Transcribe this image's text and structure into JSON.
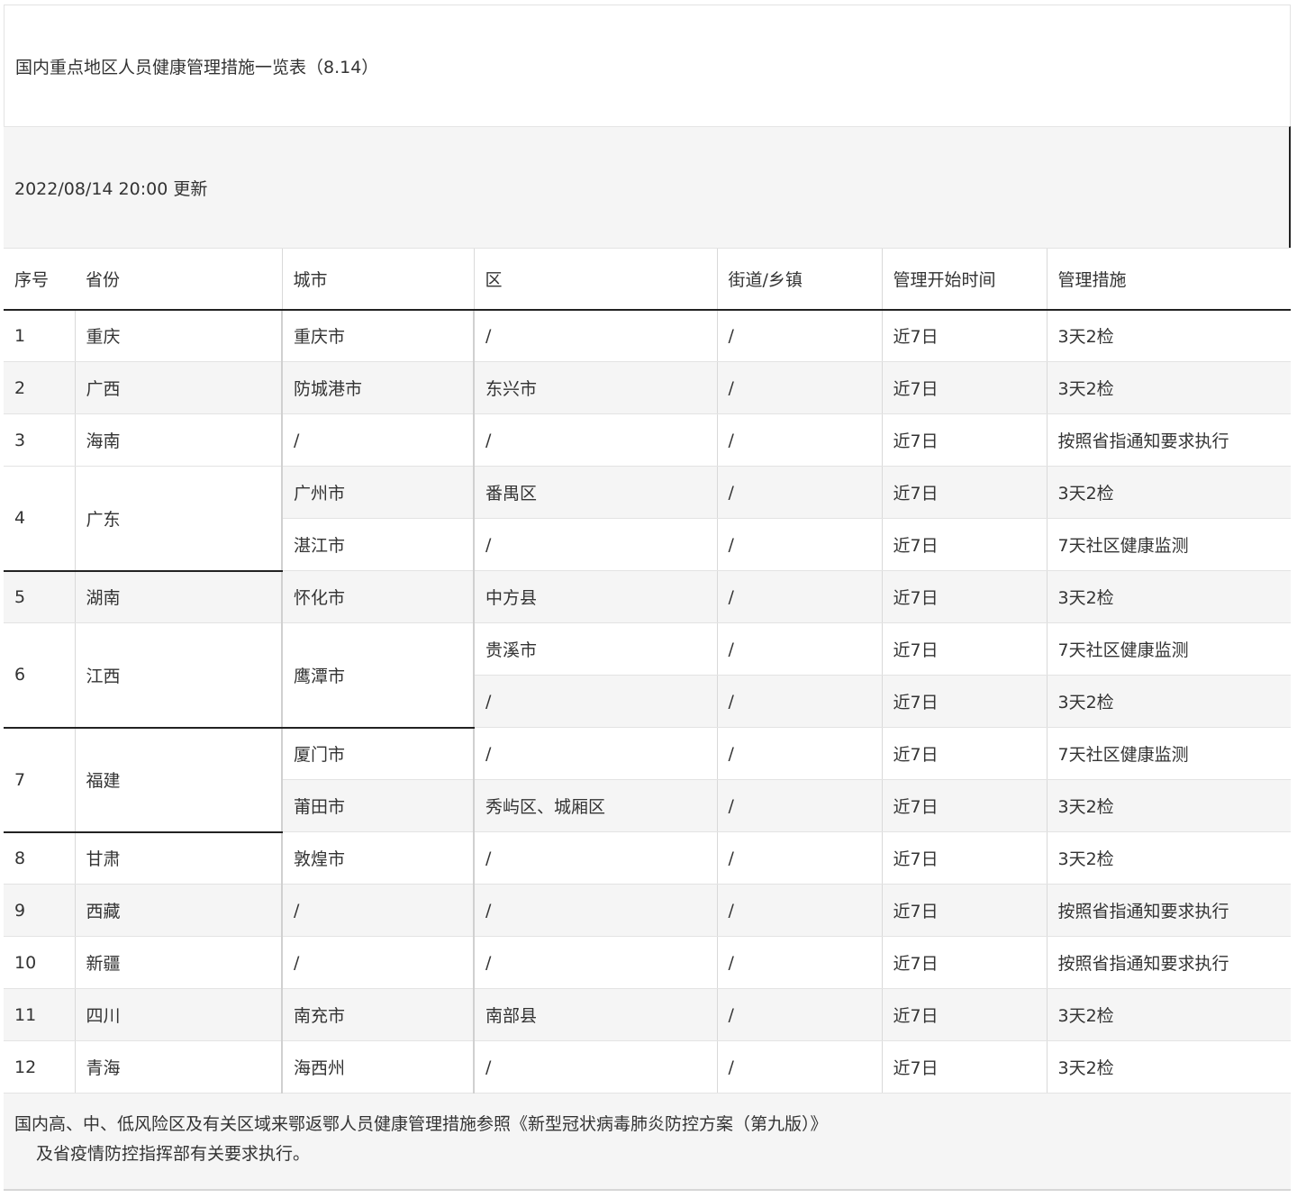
{
  "title": "国内重点地区人员健康管理措施一览表（8.14）",
  "update_time": "2022/08/14 20:00 更新",
  "table": {
    "headers": [
      "序号",
      "省份",
      "城市",
      "区",
      "街道/乡镇",
      "管理开始时间",
      "管理措施"
    ],
    "rows": [
      {
        "no": "1",
        "province": "重庆",
        "city": "重庆市",
        "district": "/",
        "street": "/",
        "start": "近7日",
        "measure": "3天2检"
      },
      {
        "no": "2",
        "province": "广西",
        "city": "防城港市",
        "district": "东兴市",
        "street": "/",
        "start": "近7日",
        "measure": "3天2检"
      },
      {
        "no": "3",
        "province": "海南",
        "city": "/",
        "district": "/",
        "street": "/",
        "start": "近7日",
        "measure": "按照省指通知要求执行"
      },
      {
        "no": "4",
        "province": "广东",
        "city": "广州市",
        "district": "番禺区",
        "street": "/",
        "start": "近7日",
        "measure": "3天2检"
      },
      {
        "no": "",
        "province": "",
        "city": "湛江市",
        "district": "/",
        "street": "/",
        "start": "近7日",
        "measure": "7天社区健康监测"
      },
      {
        "no": "5",
        "province": "湖南",
        "city": "怀化市",
        "district": "中方县",
        "street": "/",
        "start": "近7日",
        "measure": "3天2检"
      },
      {
        "no": "6",
        "province": "江西",
        "city": "鹰潭市",
        "district": "贵溪市",
        "street": "/",
        "start": "近7日",
        "measure": "7天社区健康监测"
      },
      {
        "no": "",
        "province": "",
        "city": "",
        "district": "/",
        "street": "/",
        "start": "近7日",
        "measure": "3天2检"
      },
      {
        "no": "7",
        "province": "福建",
        "city": "厦门市",
        "district": "/",
        "street": "/",
        "start": "近7日",
        "measure": "7天社区健康监测"
      },
      {
        "no": "",
        "province": "",
        "city": "莆田市",
        "district": "秀屿区、城厢区",
        "street": "/",
        "start": "近7日",
        "measure": "3天2检"
      },
      {
        "no": "8",
        "province": "甘肃",
        "city": "敦煌市",
        "district": "/",
        "street": "/",
        "start": "近7日",
        "measure": "3天2检"
      },
      {
        "no": "9",
        "province": "西藏",
        "city": "/",
        "district": "/",
        "street": "/",
        "start": "近7日",
        "measure": "按照省指通知要求执行"
      },
      {
        "no": "10",
        "province": "新疆",
        "city": "/",
        "district": "/",
        "street": "/",
        "start": "近7日",
        "measure": "按照省指通知要求执行"
      },
      {
        "no": "11",
        "province": "四川",
        "city": "南充市",
        "district": "南部县",
        "street": "/",
        "start": "近7日",
        "measure": "3天2检"
      },
      {
        "no": "12",
        "province": "青海",
        "city": "海西州",
        "district": "/",
        "street": "/",
        "start": "近7日",
        "measure": "3天2检"
      }
    ]
  },
  "footer": {
    "line1": "国内高、中、低风险区及有关区域来鄂返鄂人员健康管理措施参照《新型冠状病毒肺炎防控方案（第九版）》",
    "line2": "及省疫情防控指挥部有关要求执行。"
  }
}
